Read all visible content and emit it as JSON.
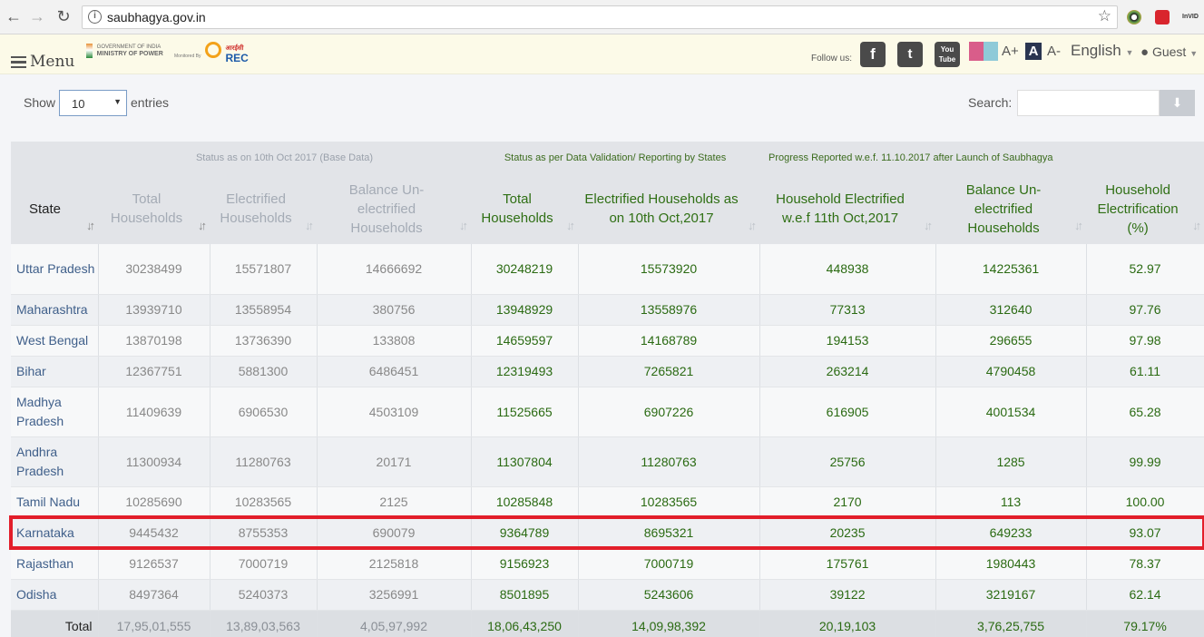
{
  "browser": {
    "url": "saubhagya.gov.in",
    "info_icon": "i",
    "nav": {
      "back": "←",
      "forward": "→",
      "reload": "↻"
    },
    "bookmark_star": "☆",
    "extensions": [
      "color-extension-icon",
      "red-extension-icon",
      "invid-extension-icon"
    ],
    "invid_label": "InVID"
  },
  "header": {
    "menu_label": "Menu",
    "ministry_small": "GOVERNMENT OF INDIA",
    "ministry_name": "MINISTRY OF POWER",
    "monitored_by": "Monitored By",
    "rec_hindi": "आरईसी",
    "rec_name": "REC",
    "follow_label": "Follow us:",
    "social": {
      "facebook": "f",
      "twitter": "t",
      "youtube": "You Tube"
    },
    "font_increase": "A+",
    "font_normal": "A",
    "font_decrease": "A-",
    "language": "English",
    "user": "Guest"
  },
  "controls": {
    "show_label": "Show",
    "entries_value": "10",
    "entries_suffix": "entries",
    "search_label": "Search:",
    "search_value": ""
  },
  "table": {
    "groups": {
      "base": "Status as on 10th Oct 2017 (Base Data)",
      "validation": "Status as per Data Validation/ Reporting by States",
      "progress": "Progress Reported w.e.f. 11.10.2017 after Launch of Saubhagya"
    },
    "columns": [
      "State",
      "Total Households",
      "Electrified Households",
      "Balance Un-electrified Households",
      "Total Households",
      "Electrified Households as on 10th Oct,2017",
      "Household Electrified w.e.f 11th Oct,2017",
      "Balance Un-electrified Households",
      "Household Electrification (%)"
    ],
    "rows": [
      [
        "Uttar Pradesh",
        "30238499",
        "15571807",
        "14666692",
        "30248219",
        "15573920",
        "448938",
        "14225361",
        "52.97"
      ],
      [
        "Maharashtra",
        "13939710",
        "13558954",
        "380756",
        "13948929",
        "13558976",
        "77313",
        "312640",
        "97.76"
      ],
      [
        "West Bengal",
        "13870198",
        "13736390",
        "133808",
        "14659597",
        "14168789",
        "194153",
        "296655",
        "97.98"
      ],
      [
        "Bihar",
        "12367751",
        "5881300",
        "6486451",
        "12319493",
        "7265821",
        "263214",
        "4790458",
        "61.11"
      ],
      [
        "Madhya Pradesh",
        "11409639",
        "6906530",
        "4503109",
        "11525665",
        "6907226",
        "616905",
        "4001534",
        "65.28"
      ],
      [
        "Andhra Pradesh",
        "11300934",
        "11280763",
        "20171",
        "11307804",
        "11280763",
        "25756",
        "1285",
        "99.99"
      ],
      [
        "Tamil Nadu",
        "10285690",
        "10283565",
        "2125",
        "10285848",
        "10283565",
        "2170",
        "113",
        "100.00"
      ],
      [
        "Karnataka",
        "9445432",
        "8755353",
        "690079",
        "9364789",
        "8695321",
        "20235",
        "649233",
        "93.07"
      ],
      [
        "Rajasthan",
        "9126537",
        "7000719",
        "2125818",
        "9156923",
        "7000719",
        "175761",
        "1980443",
        "78.37"
      ],
      [
        "Odisha",
        "8497364",
        "5240373",
        "3256991",
        "8501895",
        "5243606",
        "39122",
        "3219167",
        "62.14"
      ]
    ],
    "highlighted_state": "Karnataka",
    "total": [
      "Total",
      "17,95,01,555",
      "13,89,03,563",
      "4,05,97,992",
      "18,06,43,250",
      "14,09,98,392",
      "20,19,103",
      "3,76,25,755",
      "79.17%"
    ],
    "sort_icon": "↓↑"
  },
  "colors": {
    "highlight_border": "#e21e2a",
    "current_data_text": "#2a6a12",
    "base_data_text": "#888888",
    "state_link": "#3f5f8a",
    "header_bg": "#fcfae8"
  }
}
